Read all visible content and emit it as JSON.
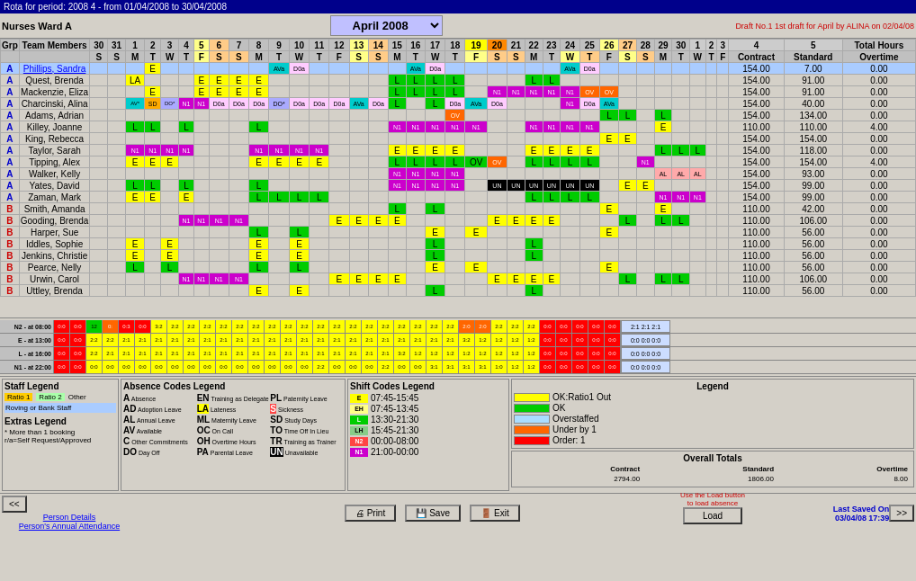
{
  "title_bar": {
    "text": "Rota for period: 2008 4 - from 01/04/2008 to 30/04/2008"
  },
  "header": {
    "ward_name": "Nurses Ward A",
    "month": "April 2008",
    "draft_info": "Draft No.1 1st draft for April by ALINA on 02/04/08"
  },
  "columns": {
    "team_members": "Team Members",
    "prev_days": [
      "30",
      "31"
    ],
    "days": [
      "1",
      "2",
      "3",
      "4",
      "5",
      "6",
      "7",
      "8",
      "9",
      "10",
      "11",
      "12",
      "13",
      "14",
      "15",
      "16",
      "17",
      "18",
      "19",
      "20",
      "21",
      "22",
      "23",
      "24",
      "25",
      "26",
      "27",
      "28",
      "29",
      "30",
      "1",
      "2",
      "3",
      "4",
      "5"
    ],
    "total_hours": "Total Hours",
    "contract": "Contract",
    "standard": "Standard",
    "overtime": "Overtime"
  },
  "people": [
    {
      "grp": "A",
      "name": "Phillips, Sandra",
      "contract": "154.00",
      "standard": "7.00",
      "overtime": "0.00",
      "highlight": true
    },
    {
      "grp": "A",
      "name": "Quest, Brenda",
      "contract": "154.00",
      "standard": "91.00",
      "overtime": "0.00"
    },
    {
      "grp": "A",
      "name": "Mackenzie, Eliza",
      "contract": "154.00",
      "standard": "91.00",
      "overtime": "0.00"
    },
    {
      "grp": "A",
      "name": "Charcinski, Alina",
      "contract": "154.00",
      "standard": "40.00",
      "overtime": "0.00"
    },
    {
      "grp": "A",
      "name": "Adams, Adrian",
      "contract": "154.00",
      "standard": "134.00",
      "overtime": "0.00"
    },
    {
      "grp": "A",
      "name": "Killey, Joanne",
      "contract": "110.00",
      "standard": "110.00",
      "overtime": "4.00"
    },
    {
      "grp": "A",
      "name": "King, Rebecca",
      "contract": "154.00",
      "standard": "154.00",
      "overtime": "0.00"
    },
    {
      "grp": "A",
      "name": "Taylor, Sarah",
      "contract": "154.00",
      "standard": "118.00",
      "overtime": "0.00"
    },
    {
      "grp": "A",
      "name": "Tipping, Alex",
      "contract": "154.00",
      "standard": "154.00",
      "overtime": "4.00"
    },
    {
      "grp": "A",
      "name": "Walker, Kelly",
      "contract": "154.00",
      "standard": "93.00",
      "overtime": "0.00"
    },
    {
      "grp": "A",
      "name": "Yates, David",
      "contract": "154.00",
      "standard": "99.00",
      "overtime": "0.00"
    },
    {
      "grp": "A",
      "name": "Zaman, Mark",
      "contract": "154.00",
      "standard": "99.00",
      "overtime": "0.00"
    },
    {
      "grp": "B",
      "name": "Smith, Amanda",
      "contract": "110.00",
      "standard": "42.00",
      "overtime": "0.00"
    },
    {
      "grp": "B",
      "name": "Gooding, Brenda",
      "contract": "110.00",
      "standard": "106.00",
      "overtime": "0.00"
    },
    {
      "grp": "B",
      "name": "Harper, Sue",
      "contract": "110.00",
      "standard": "56.00",
      "overtime": "0.00"
    },
    {
      "grp": "B",
      "name": "Iddles, Sophie",
      "contract": "110.00",
      "standard": "56.00",
      "overtime": "0.00"
    },
    {
      "grp": "B",
      "name": "Jenkins, Christie",
      "contract": "110.00",
      "standard": "56.00",
      "overtime": "0.00"
    },
    {
      "grp": "B",
      "name": "Pearce, Nelly",
      "contract": "110.00",
      "standard": "56.00",
      "overtime": "0.00"
    },
    {
      "grp": "B",
      "name": "Urwin, Carol",
      "contract": "110.00",
      "standard": "106.00",
      "overtime": "0.00"
    },
    {
      "grp": "B",
      "name": "Uttley, Brenda",
      "contract": "110.00",
      "standard": "56.00",
      "overtime": "0.00"
    }
  ],
  "staffing_labels": [
    "N2 - at 08:00",
    "E - at 13:00",
    "L - at 16:00",
    "N1 - at 22:00"
  ],
  "legend": {
    "title": "Legend",
    "items": [
      {
        "label": "OK:Ratio1 Out",
        "color": "#ffff00"
      },
      {
        "label": "OK",
        "color": "#00cc00"
      },
      {
        "label": "Overstaffed",
        "color": "#aaddff"
      },
      {
        "label": "Under by 1",
        "color": "#ff6600"
      },
      {
        "label": "Order: 1",
        "color": "#ff0000"
      }
    ]
  },
  "overall_totals": {
    "title": "Overall Totals",
    "contract": "2794.00",
    "standard": "1806.00",
    "overtime": "8.00"
  },
  "load_section": {
    "text": "Use the Load button to load absence",
    "button": "Load"
  },
  "staff_legend": {
    "title": "Staff Legend",
    "ratio1": "Ratio 1",
    "ratio2": "Ratio 2",
    "other": "Other",
    "roving": "Roving or Bank Staff",
    "extras_title": "Extras Legend",
    "extras_note": "* More than 1 booking",
    "extras_note2": "r/a=Self Request/Approved"
  },
  "absence_legend": {
    "title": "Absence Codes Legend",
    "items": [
      {
        "code": "A",
        "label": "Absence"
      },
      {
        "code": "AD",
        "label": "Adoption Leave"
      },
      {
        "code": "AL",
        "label": "Annual Leave"
      },
      {
        "code": "AV",
        "label": "Available"
      },
      {
        "code": "C",
        "label": "Other Commitments"
      },
      {
        "code": "DO",
        "label": "Day Off"
      },
      {
        "code": "EN",
        "label": "Training as Delegate"
      },
      {
        "code": "LA",
        "label": "Lateness"
      },
      {
        "code": "ML",
        "label": "Maternity Leave"
      },
      {
        "code": "OC",
        "label": "On Call"
      },
      {
        "code": "OH",
        "label": "Overtime Hours"
      },
      {
        "code": "PA",
        "label": "Parental Leave"
      },
      {
        "code": "PL",
        "label": "Paternity Leave"
      },
      {
        "code": "S",
        "label": "Sickness"
      },
      {
        "code": "SD",
        "label": "Study Days"
      },
      {
        "code": "TO",
        "label": "Time Off In Lieu"
      },
      {
        "code": "TR",
        "label": "Training as Trainer"
      },
      {
        "code": "UN",
        "label": "Unavailable"
      }
    ]
  },
  "shift_legend": {
    "title": "Shift Codes Legend",
    "items": [
      {
        "code": "E",
        "color": "#ffff00",
        "time": "07:45-15:45"
      },
      {
        "code": "EH",
        "color": "#ffff88",
        "time": "07:45-13:45"
      },
      {
        "code": "L",
        "color": "#00cc00",
        "time": "13:30-21:30"
      },
      {
        "code": "LH",
        "color": "#88cc88",
        "time": "15:45-21:30"
      },
      {
        "code": "N2",
        "color": "#ff0000",
        "time": "00:00-08:00"
      },
      {
        "code": "N1",
        "color": "#cc00cc",
        "time": "21:00-00:00"
      }
    ]
  },
  "footer": {
    "person_details": "Person Details",
    "annual_attendance": "Person's Annual Attendance",
    "print": "Print",
    "save": "Save",
    "exit": "Exit",
    "last_saved_label": "Last Saved On",
    "last_saved_date": "03/04/08",
    "last_saved_time": "17:39"
  }
}
